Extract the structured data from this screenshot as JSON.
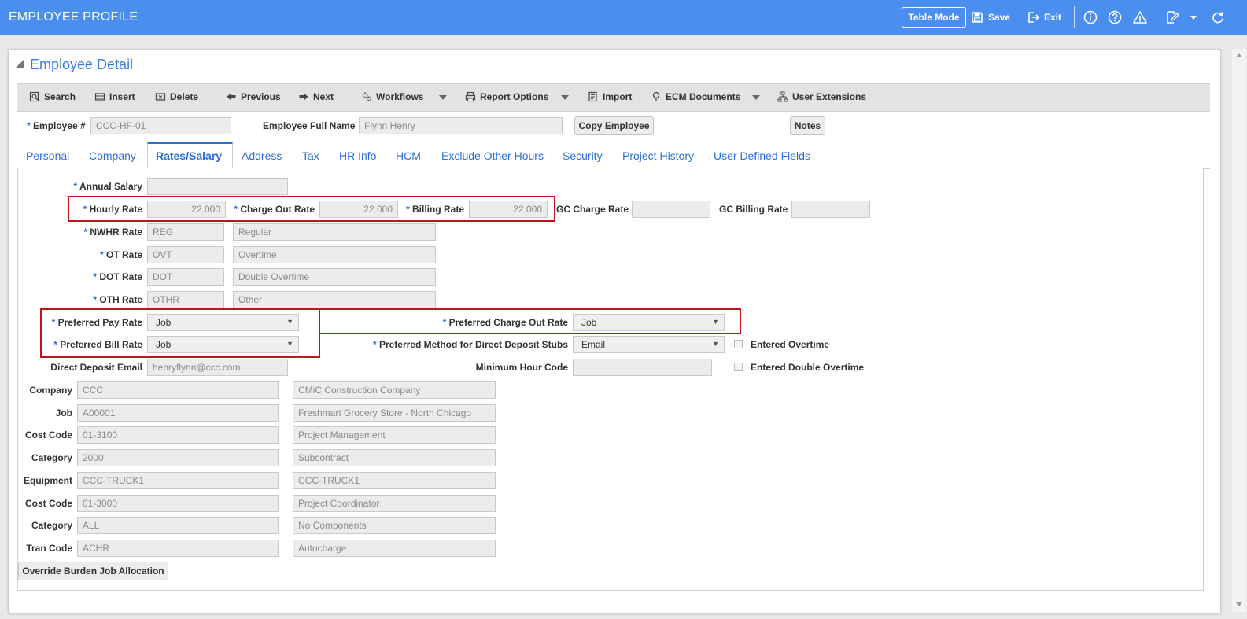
{
  "header": {
    "title": "EMPLOYEE PROFILE",
    "table_mode": "Table Mode",
    "save": "Save",
    "exit": "Exit"
  },
  "panel": {
    "title": "Employee Detail"
  },
  "toolbar": {
    "search": "Search",
    "insert": "Insert",
    "delete": "Delete",
    "previous": "Previous",
    "next": "Next",
    "workflows": "Workflows",
    "report_options": "Report Options",
    "import": "Import",
    "ecm_documents": "ECM Documents",
    "user_extensions": "User Extensions"
  },
  "employee": {
    "number_label": "Employee #",
    "number_value": "CCC-HF-01",
    "full_name_label": "Employee Full Name",
    "full_name_value": "Flynn Henry",
    "copy_employee": "Copy Employee",
    "notes": "Notes"
  },
  "tabs": [
    "Personal",
    "Company",
    "Rates/Salary",
    "Address",
    "Tax",
    "HR Info",
    "HCM",
    "Exclude Other Hours",
    "Security",
    "Project History",
    "User Defined Fields"
  ],
  "rates": {
    "annual_salary_label": "Annual Salary",
    "annual_salary_value": "",
    "hourly_rate_label": "Hourly Rate",
    "hourly_rate_value": "22.000",
    "charge_out_rate_label": "Charge Out Rate",
    "charge_out_rate_value": "22.000",
    "billing_rate_label": "Billing Rate",
    "billing_rate_value": "22.000",
    "gc_charge_rate_label": "GC Charge Rate",
    "gc_billing_rate_label": "GC Billing Rate",
    "nwhr_label": "NWHR Rate",
    "nwhr_code": "REG",
    "nwhr_desc": "Regular",
    "ot_label": "OT Rate",
    "ot_code": "OVT",
    "ot_desc": "Overtime",
    "dot_label": "DOT Rate",
    "dot_code": "DOT",
    "dot_desc": "Double Overtime",
    "oth_label": "OTH Rate",
    "oth_code": "OTHR",
    "oth_desc": "Other",
    "pref_pay_label": "Preferred Pay Rate",
    "pref_pay_value": "Job",
    "pref_bill_label": "Preferred Bill Rate",
    "pref_bill_value": "Job",
    "pref_charge_label": "Preferred Charge Out Rate",
    "pref_charge_value": "Job",
    "pref_deposit_label": "Preferred Method for Direct Deposit Stubs",
    "pref_deposit_value": "Email",
    "entered_ot_label": "Entered Overtime",
    "entered_dot_label": "Entered Double Overtime",
    "deposit_email_label": "Direct Deposit Email",
    "deposit_email_value": "henryflynn@ccc.com",
    "min_hour_label": "Minimum Hour Code",
    "min_hour_value": ""
  },
  "allocation": [
    {
      "label": "Company",
      "code": "CCC",
      "desc": "CMiC Construction Company"
    },
    {
      "label": "Job",
      "code": "A00001",
      "desc": "Freshmart Grocery Store -  North Chicago"
    },
    {
      "label": "Cost Code",
      "code": "01-3100",
      "desc": "Project Management"
    },
    {
      "label": "Category",
      "code": "2000",
      "desc": "Subcontract"
    },
    {
      "label": "Equipment",
      "code": "CCC-TRUCK1",
      "desc": "CCC-TRUCK1"
    },
    {
      "label": "Cost Code",
      "code": "01-3000",
      "desc": "Project Coordinator"
    },
    {
      "label": "Category",
      "code": "ALL",
      "desc": "No Components"
    },
    {
      "label": "Tran Code",
      "code": "ACHR",
      "desc": "Autocharge"
    }
  ],
  "override_button": "Override Burden Job Allocation",
  "colors": {
    "header_bg": "#4a8ef0",
    "link": "#2b6fd6",
    "highlight": "#c0141b"
  }
}
